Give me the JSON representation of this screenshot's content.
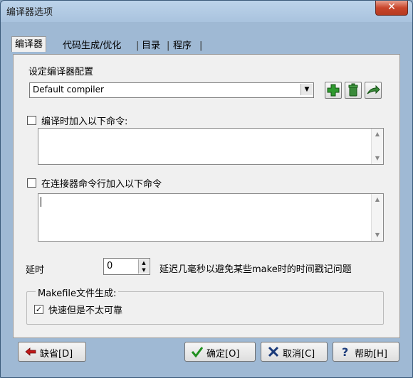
{
  "window": {
    "title": "编译器选项",
    "close_label": "✕"
  },
  "tabs": [
    {
      "label": "编译器",
      "active": true
    },
    {
      "label": "代码生成/优化"
    },
    {
      "label": "目录"
    },
    {
      "label": "程序"
    }
  ],
  "tab_separator": "|",
  "config": {
    "label": "设定编译器配置",
    "selected": "Default compiler",
    "icons": [
      "add-icon",
      "delete-icon",
      "rename-icon"
    ]
  },
  "compile_commands": {
    "label": "编译时加入以下命令:",
    "checked": false,
    "value": ""
  },
  "linker_commands": {
    "label": "在连接器命令行加入以下命令",
    "checked": false,
    "value": ""
  },
  "delay": {
    "label": "延时",
    "value": "0",
    "description": "延迟几毫秒以避免某些make时的时间戳记问题"
  },
  "makefile": {
    "group_title": "Makefile文件生成:",
    "fast_label": "快速但是不太可靠",
    "fast_checked": true
  },
  "buttons": {
    "default_label": "缺省[D]",
    "ok_label": "确定[O]",
    "cancel_label": "取消[C]",
    "help_label": "帮助[H]"
  },
  "colors": {
    "add": "#2e9a2e",
    "delete": "#3a8a3a",
    "ok": "#1f8f1f",
    "cancel": "#1a3a7a",
    "back_arrow": "#c01818"
  }
}
